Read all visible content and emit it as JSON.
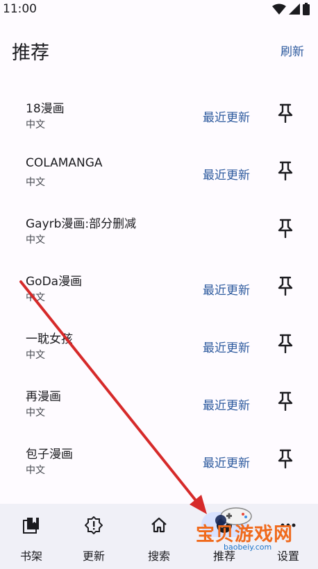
{
  "status": {
    "time": "11:00"
  },
  "header": {
    "title": "推荐",
    "refresh_label": "刷新"
  },
  "sources": [
    {
      "name": "18漫画",
      "lang": "中文",
      "action": "最近更新"
    },
    {
      "name": "COLAMANGA",
      "lang": "中文",
      "action": "最近更新"
    },
    {
      "name": "Gayrb漫画:部分删减",
      "lang": "中文",
      "action": ""
    },
    {
      "name": "GoDa漫画",
      "lang": "中文",
      "action": "最近更新"
    },
    {
      "name": "一耽女孩",
      "lang": "中文",
      "action": "最近更新"
    },
    {
      "name": "再漫画",
      "lang": "中文",
      "action": "最近更新"
    },
    {
      "name": "包子漫画",
      "lang": "中文",
      "action": "最近更新"
    }
  ],
  "bottom_nav": [
    {
      "label": "书架",
      "icon": "library-icon"
    },
    {
      "label": "更新",
      "icon": "update-alert-icon"
    },
    {
      "label": "搜索",
      "icon": "home-icon"
    },
    {
      "label": "推荐",
      "icon": "explore-icon",
      "active": true
    },
    {
      "label": "设置",
      "icon": "more-icon"
    }
  ],
  "watermark": {
    "text": "宝贝游戏网",
    "sub": "baobeiy.com"
  },
  "colors": {
    "accent": "#2d5a9e",
    "nav_bg": "#f0f0f7",
    "arrow": "#d62a2a"
  }
}
